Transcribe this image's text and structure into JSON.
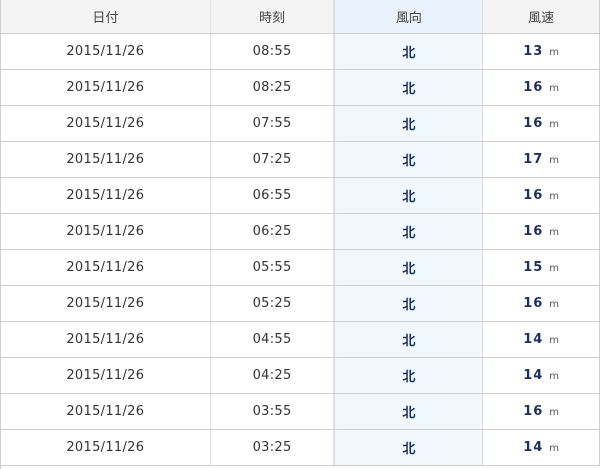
{
  "table": {
    "headers": {
      "date": "日付",
      "time": "時刻",
      "direction": "風向",
      "speed": "風速"
    },
    "speed_unit": "m",
    "rows": [
      {
        "date": "2015/11/26",
        "time": "08:55",
        "direction": "北",
        "speed": "13"
      },
      {
        "date": "2015/11/26",
        "time": "08:25",
        "direction": "北",
        "speed": "16"
      },
      {
        "date": "2015/11/26",
        "time": "07:55",
        "direction": "北",
        "speed": "16"
      },
      {
        "date": "2015/11/26",
        "time": "07:25",
        "direction": "北",
        "speed": "17"
      },
      {
        "date": "2015/11/26",
        "time": "06:55",
        "direction": "北",
        "speed": "16"
      },
      {
        "date": "2015/11/26",
        "time": "06:25",
        "direction": "北",
        "speed": "16"
      },
      {
        "date": "2015/11/26",
        "time": "05:55",
        "direction": "北",
        "speed": "15"
      },
      {
        "date": "2015/11/26",
        "time": "05:25",
        "direction": "北",
        "speed": "16"
      },
      {
        "date": "2015/11/26",
        "time": "04:55",
        "direction": "北",
        "speed": "14"
      },
      {
        "date": "2015/11/26",
        "time": "04:25",
        "direction": "北",
        "speed": "14"
      },
      {
        "date": "2015/11/26",
        "time": "03:55",
        "direction": "北",
        "speed": "16"
      },
      {
        "date": "2015/11/26",
        "time": "03:25",
        "direction": "北",
        "speed": "14"
      }
    ]
  }
}
